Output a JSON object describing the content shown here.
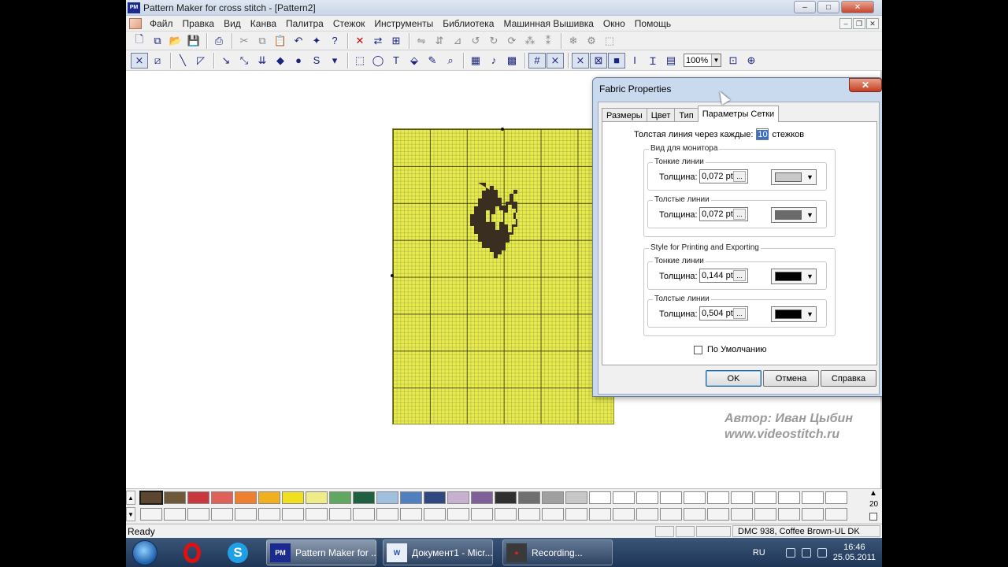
{
  "window": {
    "title": "Pattern Maker for cross stitch - [Pattern2]",
    "icon_text": "PM",
    "min": "–",
    "max": "□",
    "close": "✕"
  },
  "menu": {
    "items": [
      "Файл",
      "Правка",
      "Вид",
      "Канва",
      "Палитра",
      "Стежок",
      "Инструменты",
      "Библиотека",
      "Машинная Вышивка",
      "Окно",
      "Помощь"
    ],
    "mdi_min": "–",
    "mdi_restore": "❐",
    "mdi_close": "✕"
  },
  "toolbar": {
    "zoom_value": "100%"
  },
  "watermark": {
    "line1": "Автор: Иван Цыбин",
    "line2": "www.videostitch.ru"
  },
  "palette": {
    "colors": [
      "#5b4630",
      "#6e5a3a",
      "#c8383c",
      "#e0605a",
      "#f08030",
      "#f0b020",
      "#f0e020",
      "#f0ec88",
      "#60a860",
      "#1f6040",
      "#a0c0e0",
      "#5080c0",
      "#304880",
      "#c8b0d0",
      "#806098",
      "#303030",
      "#707070",
      "#a0a0a0",
      "#c8c8c8",
      "#ffffff",
      "#ffffff",
      "#ffffff",
      "#ffffff",
      "#ffffff",
      "#ffffff",
      "#ffffff",
      "#ffffff",
      "#ffffff",
      "#ffffff",
      "#ffffff"
    ],
    "selected_index": 0,
    "side_number": "20"
  },
  "status": {
    "ready": "Ready",
    "color_info": "DMC  938, Coffee Brown-UL DK"
  },
  "taskbar": {
    "tasks": [
      {
        "label": "Pattern Maker for ...",
        "icon": "PM"
      },
      {
        "label": "Документ1 - Micr...",
        "icon": "W"
      },
      {
        "label": "Recording...",
        "icon": "●"
      }
    ],
    "lang": "RU",
    "time": "16:46",
    "date": "25.05.2011"
  },
  "dialog": {
    "title": "Fabric Properties",
    "close": "✕",
    "tabs": [
      "Размеры",
      "Цвет",
      "Тип",
      "Параметры Сетки"
    ],
    "active_tab": 3,
    "thick_every_label": "Толстая линия через каждые:",
    "thick_every_value": "10",
    "thick_every_unit": "стежков",
    "monitor": {
      "title": "Вид для монитора",
      "thin": {
        "title": "Тонкие линии",
        "label": "Толщина:",
        "value": "0,072 pt",
        "color": "#c8c8c8"
      },
      "thick": {
        "title": "Толстые линии",
        "label": "Толщина:",
        "value": "0,072 pt",
        "color": "#6a6a6a"
      }
    },
    "print": {
      "title": "Style for Printing and Exporting",
      "thin": {
        "title": "Тонкие линии",
        "label": "Толщина:",
        "value": "0,144 pt",
        "color": "#000000"
      },
      "thick": {
        "title": "Толстые линии",
        "label": "Толщина:",
        "value": "0,504 pt",
        "color": "#000000"
      }
    },
    "default_label": "По Умолчанию",
    "ok": "OK",
    "cancel": "Отмена",
    "help": "Справка"
  }
}
